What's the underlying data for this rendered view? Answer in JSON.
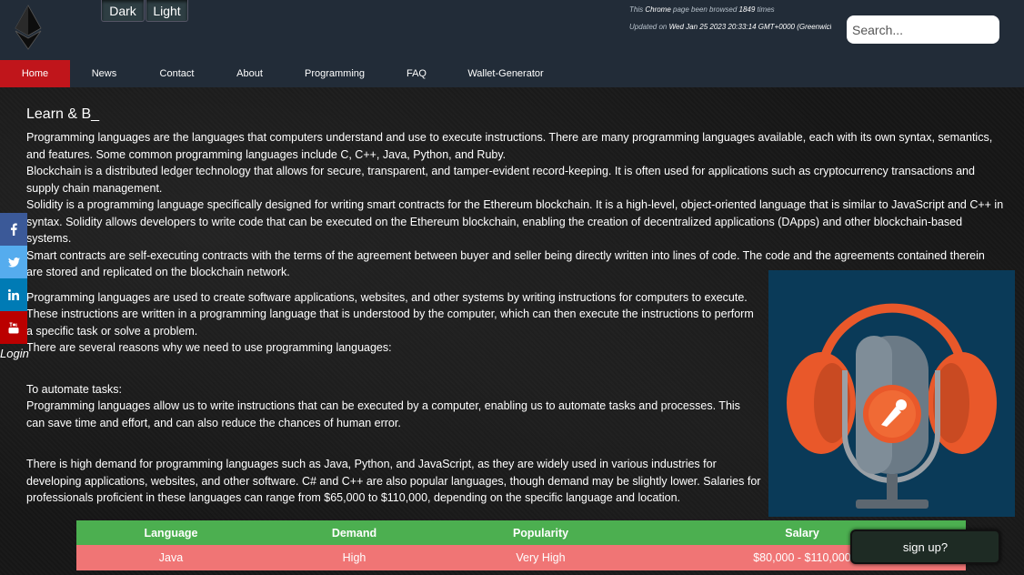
{
  "header": {
    "theme_dark": "Dark",
    "theme_light": "Light",
    "browse_prefix": "This ",
    "browse_browser": "Chrome",
    "browse_middle": " page been browsed ",
    "browse_count": "1849",
    "browse_suffix": " times",
    "updated_prefix": "Updated on ",
    "updated_value": "Wed Jan 25 2023 20:33:14 GMT+0000 (Greenwich",
    "search_placeholder": "Search..."
  },
  "nav": {
    "items": [
      {
        "label": "Home"
      },
      {
        "label": "News"
      },
      {
        "label": "Contact"
      },
      {
        "label": "About"
      },
      {
        "label": "Programming"
      },
      {
        "label": "FAQ"
      },
      {
        "label": "Wallet-Generator"
      }
    ]
  },
  "sidebar": {
    "social": [
      {
        "icon": "facebook-icon"
      },
      {
        "icon": "twitter-icon"
      },
      {
        "icon": "linkedin-icon"
      },
      {
        "icon": "youtube-icon"
      }
    ],
    "login": "Login"
  },
  "main": {
    "heading": "Learn & B_",
    "p1": "Programming languages are the languages that computers understand and use to execute instructions. There are many programming languages available, each with its own syntax, semantics, and features. Some common programming languages include C, C++, Java, Python, and Ruby.",
    "p2": "Blockchain is a distributed ledger technology that allows for secure, transparent, and tamper-evident record-keeping. It is often used for applications such as cryptocurrency transactions and supply chain management.",
    "p3": "Solidity is a programming language specifically designed for writing smart contracts for the Ethereum blockchain. It is a high-level, object-oriented language that is similar to JavaScript and C++ in syntax. Solidity allows developers to write code that can be executed on the Ethereum blockchain, enabling the creation of decentralized applications (DApps) and other blockchain-based systems.",
    "p4": "Smart contracts are self-executing contracts with the terms of the agreement between buyer and seller being directly written into lines of code. The code and the agreements contained therein are stored and replicated on the blockchain network.",
    "p5": "Programming languages are used to create software applications, websites, and other systems by writing instructions for computers to execute.",
    "p6": "These instructions are written in a programming language that is understood by the computer, which can then execute the instructions to perform a specific task or solve a problem.",
    "p7": "There are several reasons why we need to use programming languages:",
    "p8": "To automate tasks:",
    "p9": "Programming languages allow us to write instructions that can be executed by a computer, enabling us to automate tasks and processes. This can save time and effort, and can also reduce the chances of human error.",
    "p10": "There is high demand for programming languages such as Java, Python, and JavaScript, as they are widely used in various industries for developing applications, websites, and other software. C# and C++ are also popular languages, though demand may be slightly lower. Salaries for professionals proficient in these languages can range from $65,000 to $110,000, depending on the specific language and location."
  },
  "table": {
    "headers": [
      "Language",
      "Demand",
      "Popularity",
      "Salary"
    ],
    "rows": [
      [
        "Java",
        "High",
        "Very High",
        "$80,000 - $110,000"
      ]
    ]
  },
  "signup": "sign up?",
  "colors": {
    "header_bg": "#222c38",
    "nav_active": "#c0151b",
    "table_header": "#4caf50",
    "table_row": "#f07575",
    "mic_bg": "#0a3a58"
  }
}
